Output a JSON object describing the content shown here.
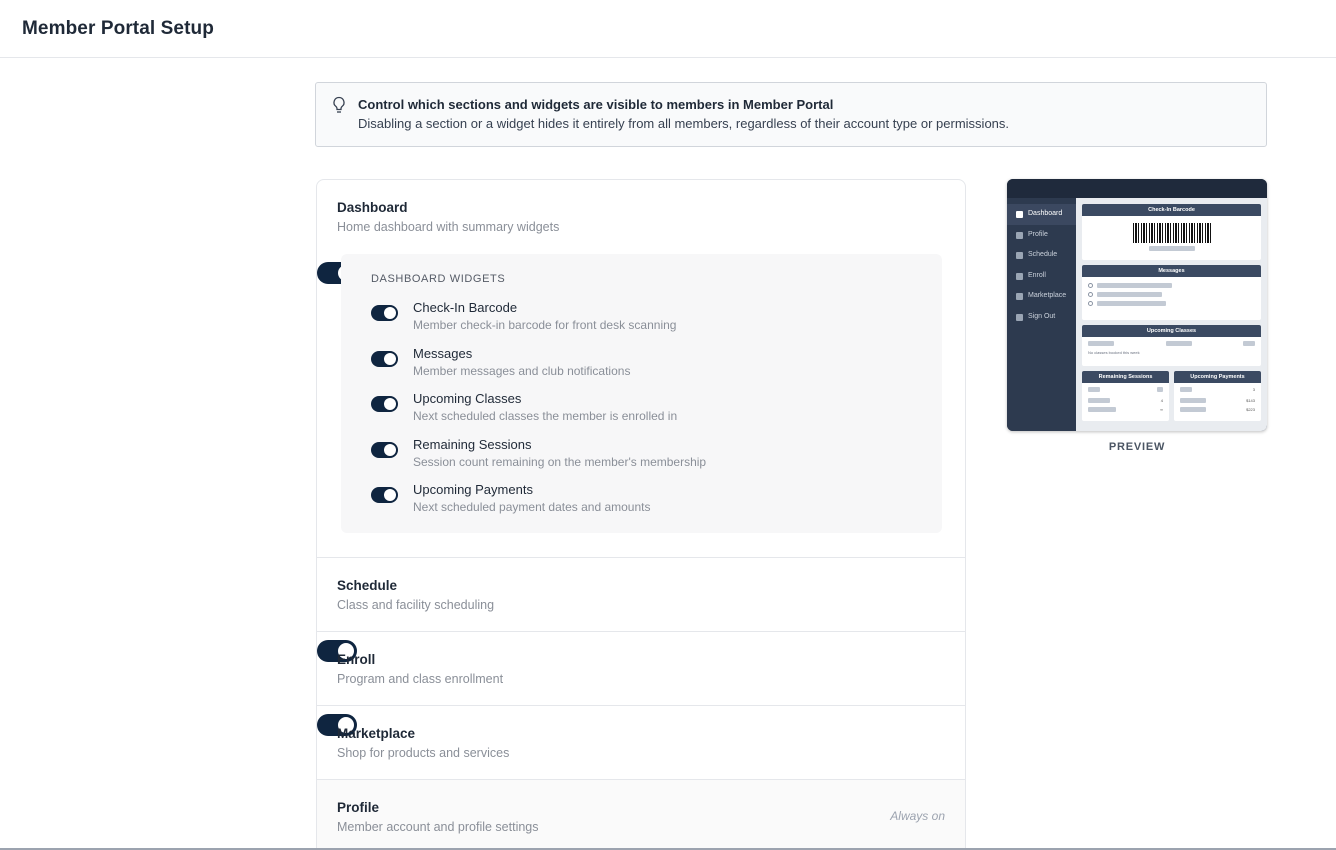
{
  "header": {
    "title": "Member Portal Setup"
  },
  "banner": {
    "icon": "lightbulb-icon",
    "title": "Control which sections and widgets are visible to members in Member Portal",
    "description": "Disabling a section or a widget hides it entirely from all members, regardless of their account type or permissions."
  },
  "sections": {
    "dashboard": {
      "name": "Dashboard",
      "description": "Home dashboard with summary widgets",
      "enabled": true
    },
    "schedule": {
      "name": "Schedule",
      "description": "Class and facility scheduling",
      "enabled": true
    },
    "enroll": {
      "name": "Enroll",
      "description": "Program and class enrollment",
      "enabled": true
    },
    "marketplace": {
      "name": "Marketplace",
      "description": "Shop for products and services",
      "enabled": true
    },
    "profile": {
      "name": "Profile",
      "description": "Member account and profile settings",
      "status": "Always on"
    }
  },
  "widgets": {
    "heading": "DASHBOARD WIDGETS",
    "items": [
      {
        "name": "Check-In Barcode",
        "description": "Member check-in barcode for front desk scanning",
        "enabled": true
      },
      {
        "name": "Messages",
        "description": "Member messages and club notifications",
        "enabled": true
      },
      {
        "name": "Upcoming Classes",
        "description": "Next scheduled classes the member is enrolled in",
        "enabled": true
      },
      {
        "name": "Remaining Sessions",
        "description": "Session count remaining on the member's membership",
        "enabled": true
      },
      {
        "name": "Upcoming Payments",
        "description": "Next scheduled payment dates and amounts",
        "enabled": true
      }
    ]
  },
  "preview": {
    "label": "PREVIEW",
    "nav": [
      "Dashboard",
      "Profile",
      "Schedule",
      "Enroll",
      "Marketplace",
      "Sign Out"
    ],
    "cards": {
      "barcode": "Check-In Barcode",
      "messages": "Messages",
      "classes": "Upcoming Classes",
      "classes_empty": "No classes booked this week",
      "sessions": "Remaining Sessions",
      "payments": "Upcoming Payments"
    },
    "mini_values": {
      "s1": "3",
      "s2": "4",
      "s3": "∞",
      "p1": "3",
      "p2": "$143",
      "p3": "$223"
    }
  },
  "colors": {
    "toggle_on": "#0f2540",
    "preview_sidebar": "#2d3a4f",
    "preview_header": "#3b4a62"
  }
}
